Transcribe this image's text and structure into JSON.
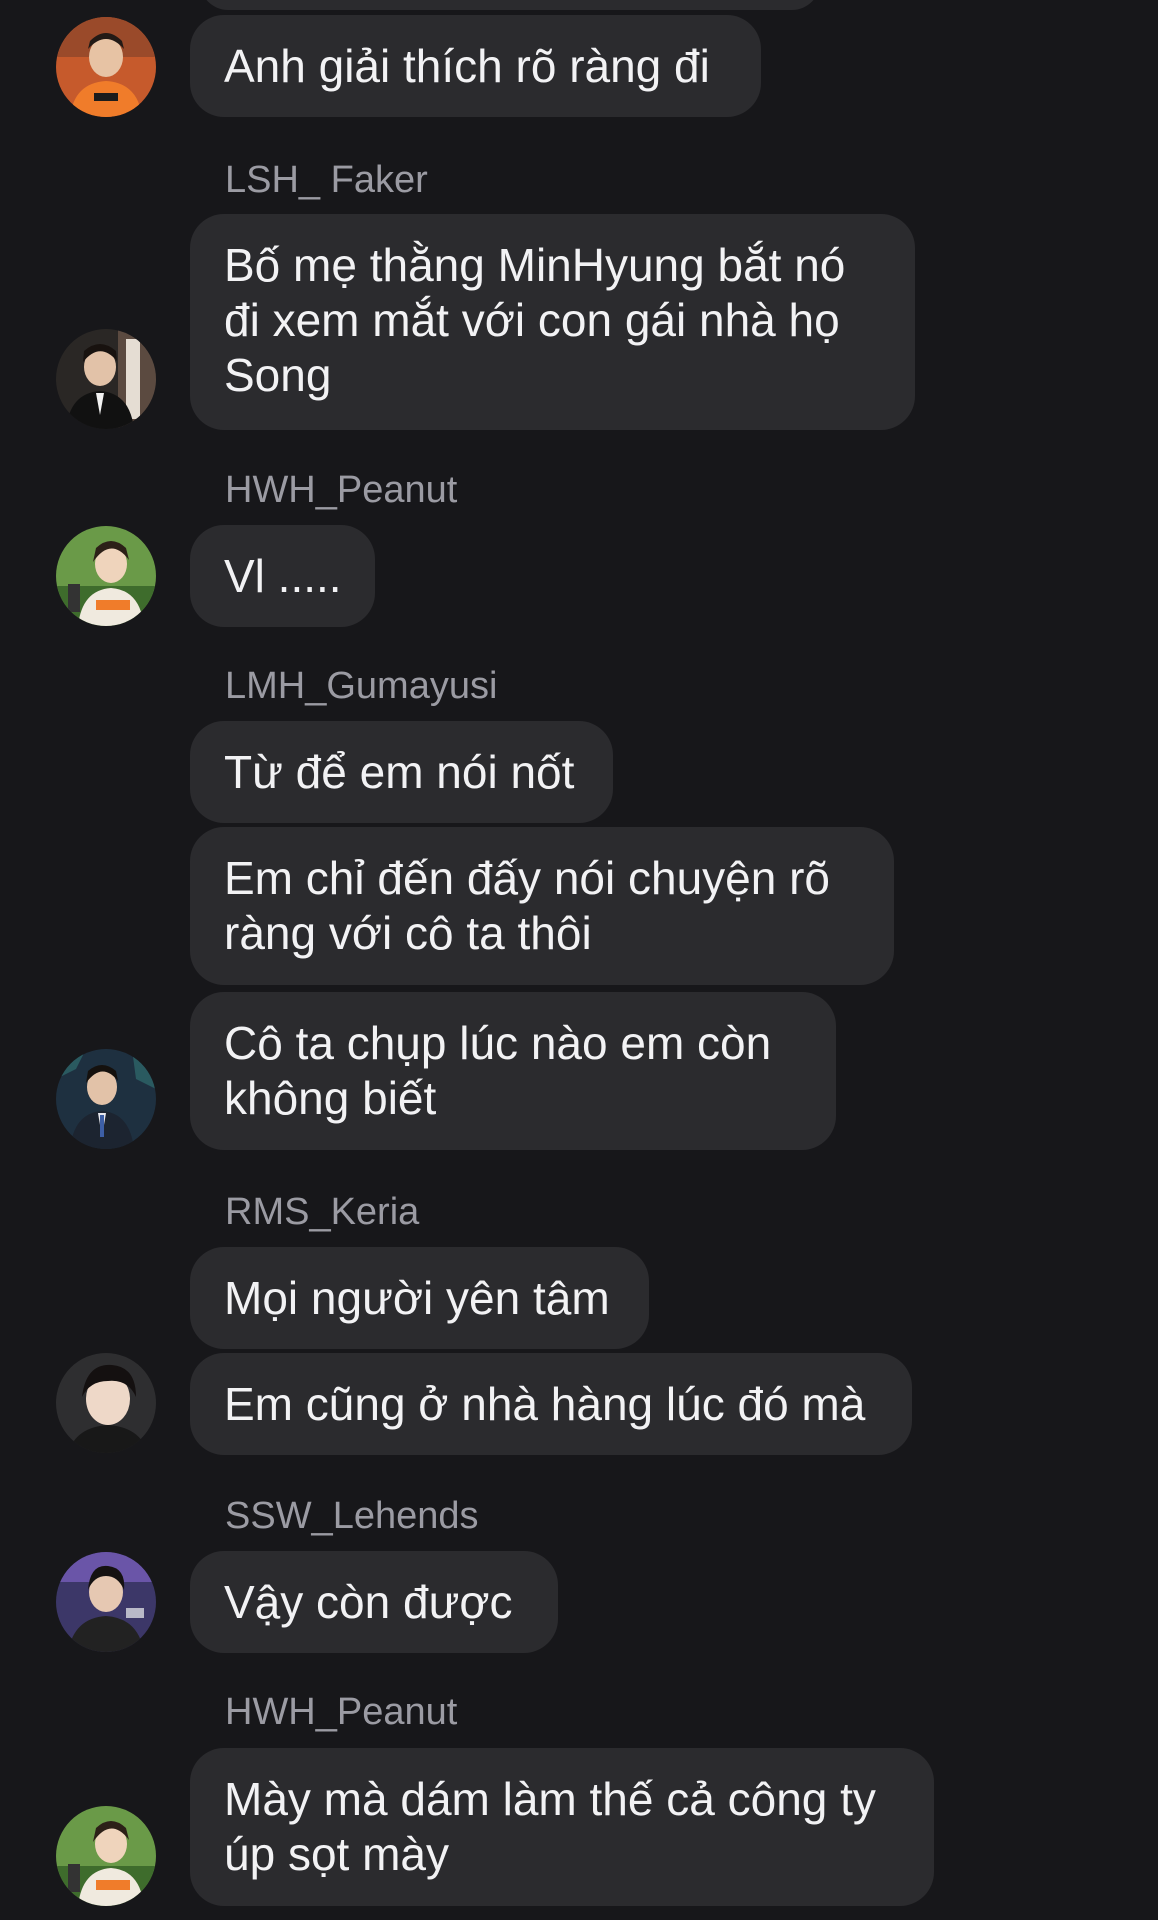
{
  "messages": [
    {
      "text": "Anh giải thích rõ ràng đi"
    },
    {
      "sender": "LSH_ Faker",
      "text": "Bố mẹ thằng MinHyung bắt nó\nđi xem mắt với con gái nhà họ\nSong"
    },
    {
      "sender": "HWH_Peanut",
      "text": "Vl ....."
    },
    {
      "sender": "LMH_Gumayusi",
      "texts": [
        "Từ để em nói nốt",
        "Em chỉ đến đấy nói chuyện rõ\nràng với cô ta thôi",
        "Cô ta chụp lúc nào em còn\nkhông biết"
      ]
    },
    {
      "sender": "RMS_Keria",
      "texts": [
        "Mọi người yên tâm",
        "Em cũng ở nhà hàng lúc đó mà"
      ]
    },
    {
      "sender": "SSW_Lehends",
      "text": "Vậy còn được"
    },
    {
      "sender": "HWH_Peanut",
      "text": "Mày mà dám làm thế cả công ty\núp sọt mày"
    }
  ],
  "colors": {
    "background": "#17171a",
    "bubble": "#2b2b2e",
    "bubble_text": "#f2f2f4",
    "sender_name": "#9b9ba3"
  },
  "icons": {
    "avatar": "user-avatar-photo"
  }
}
